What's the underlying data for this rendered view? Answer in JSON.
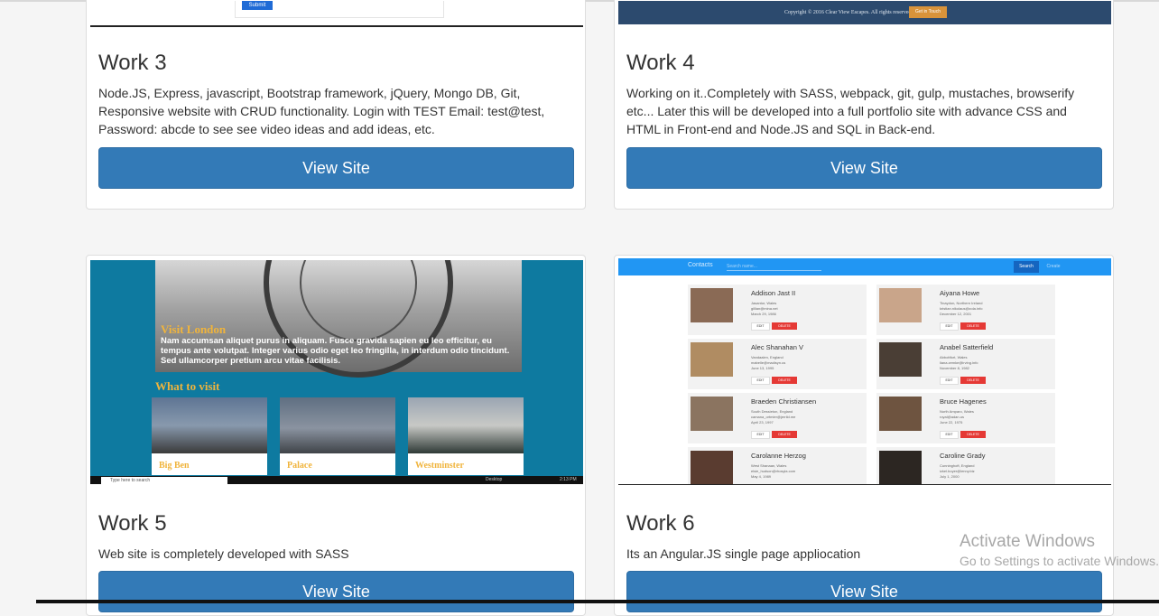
{
  "work3": {
    "title": "Work 3",
    "description": "Node.JS, Express, javascript, Bootstrap framework, jQuery, Mongo DB, Git, Responsive website with CRUD functionality. Login with TEST Email: test@test, Password: abcde to see see video ideas and add ideas, etc.",
    "button": "View Site",
    "thumb": {
      "submit_label": "Submit"
    }
  },
  "work4": {
    "title": "Work 4",
    "description": "Working on it..Completely with SASS, webpack, git, gulp, mustaches, browserify etc... Later this will be developed into a full portfolio site with advance CSS and HTML in Front-end and Node.JS and SQL in Back-end.",
    "button": "View Site",
    "thumb": {
      "copyright": "Copyright © 2016 Clear View Escapes. All rights reserved.",
      "cta": "Get in Touch"
    }
  },
  "work5": {
    "title": "Work 5",
    "description": "Web site is completely developed with SASS",
    "button": "View Site",
    "thumb": {
      "visit_heading": "Visit London",
      "hero_text": "Nam accumsan aliquet purus in aliquam. Fusce gravida sapien eu leo efficitur, eu tempus ante volutpat. Integer varius odio eget leo fringilla, in interdum odio tincidunt. Sed ullamcorper pretium arcu vitae facilisis.",
      "what_to_visit": "What to visit",
      "places": [
        "Big Ben",
        "Palace",
        "Westminster"
      ],
      "taskbar_search": "Type here to search",
      "taskbar_desktop": "Desktop",
      "taskbar_time": "2:13 PM"
    }
  },
  "work6": {
    "title": "Work 6",
    "description": "Its an Angular.JS single page appliocation",
    "button": "View Site",
    "thumb": {
      "brand": "Contacts",
      "search_placeholder": "Search name...",
      "search_button": "Search",
      "create_button": "Create",
      "edit_label": "EDIT",
      "delete_label": "DELETE",
      "contacts": [
        {
          "name": "Addison Jast II",
          "l1": "Jasantor, Wales",
          "l2": "gillian@mina.net",
          "l3": "March 29, 1986"
        },
        {
          "name": "Aiyana Howe",
          "l1": "Tinaydon, Northern Ireland",
          "l2": "kristian.nikolaus@zola.info",
          "l3": "December 12, 2001"
        },
        {
          "name": "Alec Shanahan V",
          "l1": "Vandaalen, England",
          "l2": "mabelle@madisyn.us",
          "l3": "June 13, 1995"
        },
        {
          "name": "Anabel Satterfield",
          "l1": "Abbottfort, Wales",
          "l2": "liana.zemke@irving.info",
          "l3": "November 8, 1982"
        },
        {
          "name": "Braeden Christiansen",
          "l1": "South Dessieton, England",
          "l2": "camana_ortmier@jerrild.me",
          "l3": "April 23, 1997"
        },
        {
          "name": "Bruce Hagenes",
          "l1": "North Amparo, Wales",
          "l2": "royal@adan.us",
          "l3": "June 22, 1975"
        },
        {
          "name": "Carolanne Herzog",
          "l1": "West Shanaan, Wales",
          "l2": "elsie_hudson@rhosyla.com",
          "l3": "May 4, 1989"
        },
        {
          "name": "Caroline Grady",
          "l1": "Cunninghoft, England",
          "l2": "izkel.boyer@lenny.biz",
          "l3": "July 1, 2000"
        }
      ]
    }
  },
  "watermark": {
    "line1": "Activate Windows",
    "line2": "Go to Settings to activate Windows."
  },
  "colors": {
    "button_bg": "#337ab7",
    "button_border": "#2e6da4",
    "card_border": "#dddddd"
  }
}
